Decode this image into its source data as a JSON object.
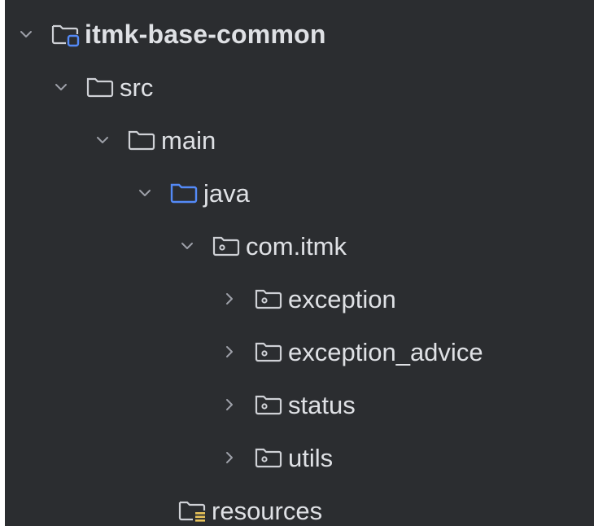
{
  "tree": {
    "root": {
      "label": "itmk-base-common",
      "expanded": true,
      "icon": "module-folder-icon"
    },
    "src": {
      "label": "src",
      "expanded": true,
      "icon": "folder-icon"
    },
    "main": {
      "label": "main",
      "expanded": true,
      "icon": "folder-icon"
    },
    "java": {
      "label": "java",
      "expanded": true,
      "icon": "source-root-folder-icon"
    },
    "com_itmk": {
      "label": "com.itmk",
      "expanded": true,
      "icon": "package-icon"
    },
    "exception": {
      "label": "exception",
      "expanded": false,
      "icon": "package-icon"
    },
    "exception_advice": {
      "label": "exception_advice",
      "expanded": false,
      "icon": "package-icon"
    },
    "status": {
      "label": "status",
      "expanded": false,
      "icon": "package-icon"
    },
    "utils": {
      "label": "utils",
      "expanded": false,
      "icon": "package-icon"
    },
    "resources": {
      "label": "resources",
      "icon": "resources-root-folder-icon"
    }
  },
  "colors": {
    "background": "#2b2d30",
    "text": "#dfe1e5",
    "icon": "#cfd1d6",
    "source_root": "#548af7",
    "resources_mark": "#e8c35a",
    "chevron": "#9da0a8"
  }
}
